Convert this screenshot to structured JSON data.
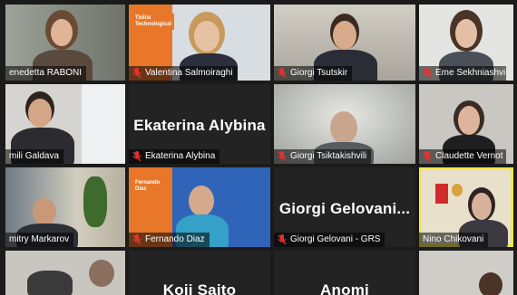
{
  "window": {
    "title": ""
  },
  "participants": [
    {
      "name": "enedetta RABONI",
      "muted": true
    },
    {
      "name": "Valentina Salmoiraghi",
      "muted": true,
      "card_text": "Tbilisi Technological"
    },
    {
      "name": "Giorgi Tsutskir",
      "muted": true
    },
    {
      "name": "Eme Sekhniashvi",
      "muted": true
    },
    {
      "name": "mili Galdava",
      "muted": false
    },
    {
      "name": "Ekaterina Alybina",
      "muted": true,
      "big_name": "Ekaterina Alybina"
    },
    {
      "name": "Giorgi Tsiktakishvili",
      "muted": true
    },
    {
      "name": "Claudette Vernot",
      "muted": true
    },
    {
      "name": "mitry Markarov",
      "muted": false
    },
    {
      "name": "Fernando Diaz",
      "muted": true,
      "card_text": "Fernando Diaz"
    },
    {
      "name": "Giorgi Gelovani - GRS",
      "muted": true,
      "big_name": "Giorgi  Gelovani..."
    },
    {
      "name": "Nino Chikovani",
      "muted": false
    },
    {
      "name": "",
      "muted": false
    },
    {
      "name": "",
      "muted": false,
      "big_name": "Koji Saito"
    },
    {
      "name": "",
      "muted": false,
      "big_name": "Anomi"
    },
    {
      "name": "",
      "muted": false
    }
  ],
  "colors": {
    "background": "#1b1b1b",
    "active_speaker": "#f2e84a",
    "mute_icon": "#e8312f",
    "brand_orange": "#e8772a"
  },
  "icons": {
    "muted": "mic-off-icon"
  }
}
